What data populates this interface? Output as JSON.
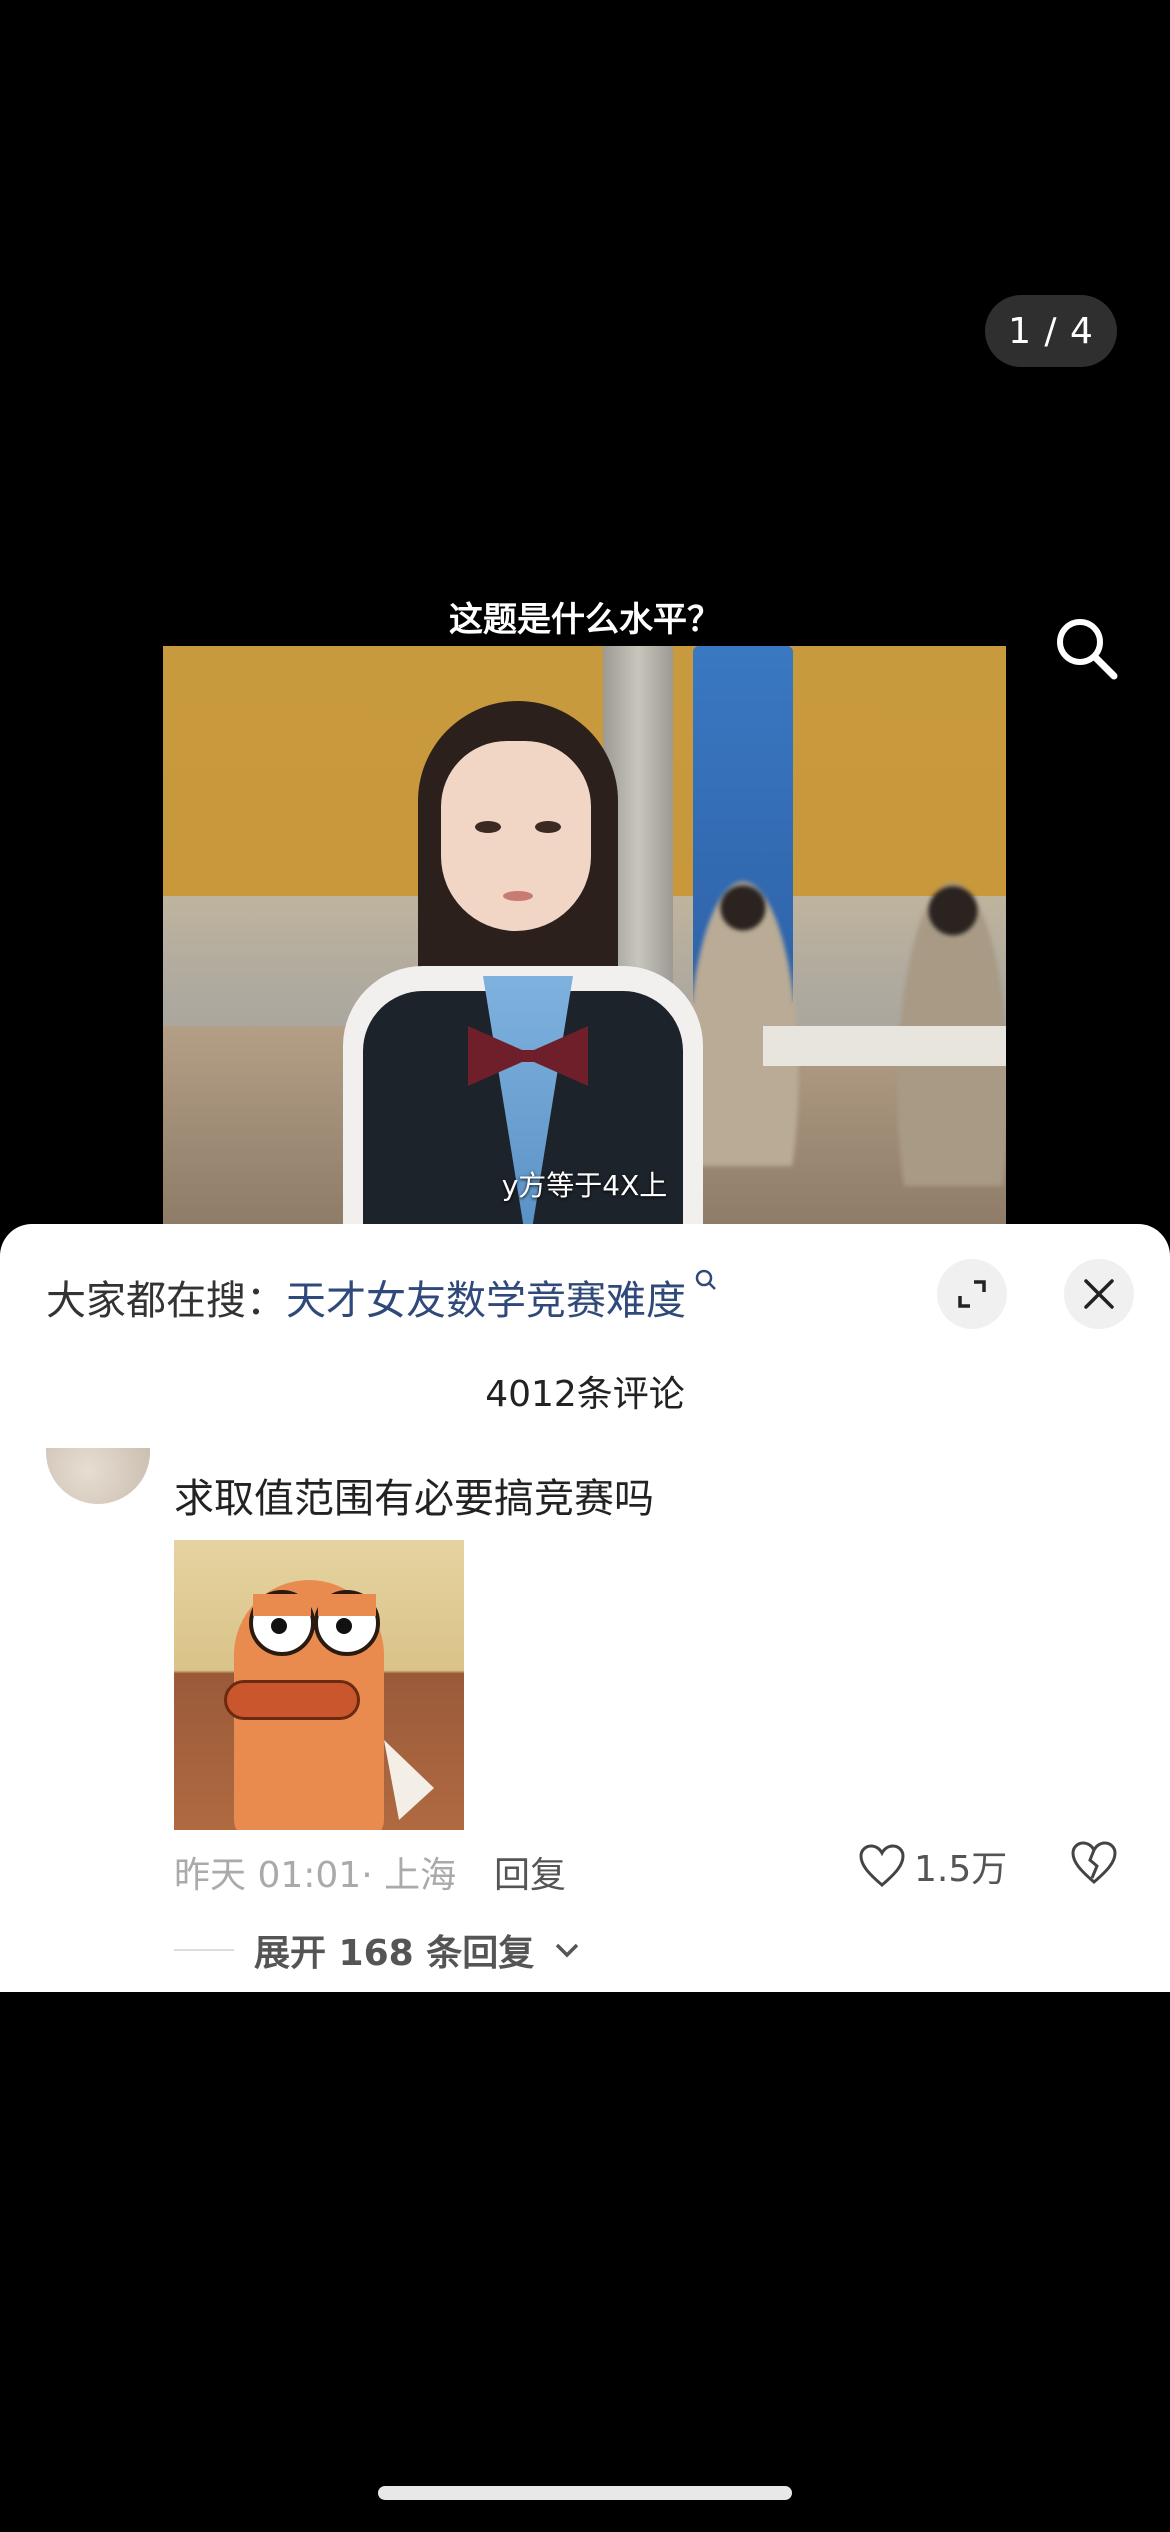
{
  "viewer": {
    "pager": "1 / 4",
    "caption": "这题是什么水平？",
    "subtitle": "y方等于4X上"
  },
  "sheet": {
    "hot_search_prefix": "大家都在搜：",
    "hot_search_term": "天才女友数学竞赛难度",
    "comment_count": "4012条评论"
  },
  "comment": {
    "text": "求取值范围有必要搞竞赛吗",
    "time_location": "昨天 01:01· 上海",
    "reply_label": "回复",
    "likes": "1.5万",
    "expand_replies": "展开 168 条回复"
  },
  "colors": {
    "background": "#000000",
    "sheet": "#ffffff",
    "link": "#2f4a7a"
  },
  "icons": [
    "search-icon",
    "expand-icon",
    "close-icon",
    "heart-icon",
    "broken-heart-icon",
    "chevron-down-icon"
  ]
}
